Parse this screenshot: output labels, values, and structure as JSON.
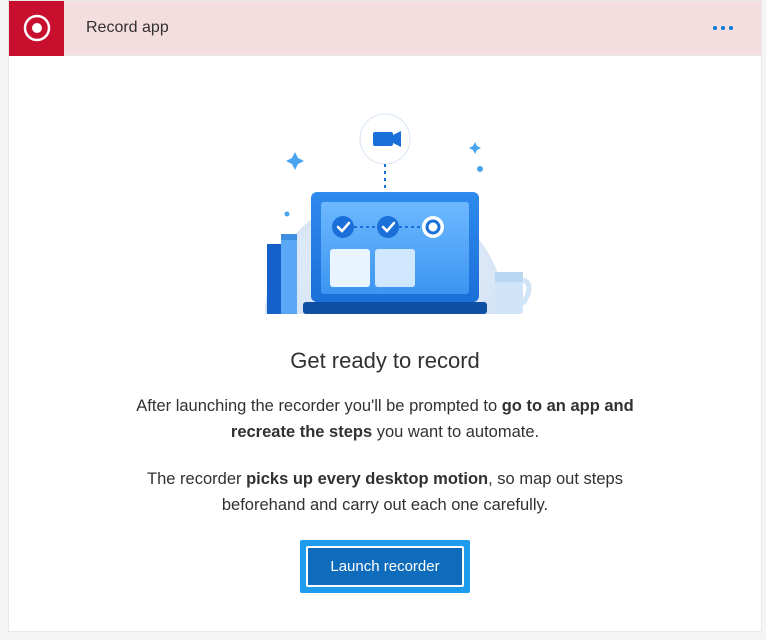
{
  "header": {
    "title": "Record app",
    "icon": "record-icon"
  },
  "content": {
    "heading": "Get ready to record",
    "para1_part1": "After launching the recorder you'll be prompted to ",
    "para1_bold": "go to an app and recreate the steps",
    "para1_part2": " you want to automate.",
    "para2_part1": "The recorder ",
    "para2_bold": "picks up every desktop motion",
    "para2_part2": ", so map out steps beforehand and carry out each one carefully.",
    "button_label": "Launch recorder"
  },
  "colors": {
    "accent_red": "#c8102e",
    "header_bg": "#f3dddf",
    "primary_blue": "#0f6cbd",
    "highlight_blue": "#1f9bf0",
    "link_blue": "#0078d4"
  }
}
